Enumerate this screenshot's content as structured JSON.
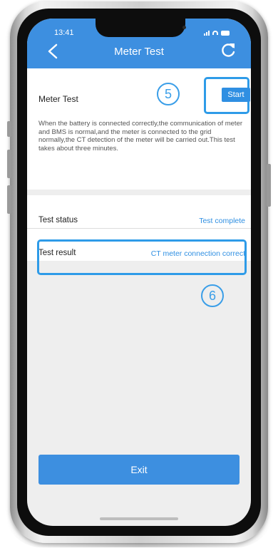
{
  "status_bar": {
    "time": "13:41"
  },
  "nav": {
    "title": "Meter Test"
  },
  "meter_test": {
    "label": "Meter Test",
    "start_label": "Start",
    "description": "When the battery is connected correctly,the communication of meter and BMS is normal,and the meter is connected to the grid normally,the CT detection of the meter will be carried out.This test takes about three minutes."
  },
  "test_status": {
    "label": "Test status",
    "value": "Test complete"
  },
  "test_result": {
    "label": "Test result",
    "value": "CT meter connection correct"
  },
  "annotations": {
    "step_5": "5",
    "step_6": "6"
  },
  "footer": {
    "exit_label": "Exit"
  },
  "icons": [
    "back-arrow-icon",
    "refresh-icon",
    "signal-icon",
    "wifi-icon",
    "battery-icon"
  ],
  "colors": {
    "nav_blue": "#3d8fe0",
    "accent_blue": "#2f8fe2",
    "highlight_blue": "#2e9be8",
    "background": "#eeeeee"
  }
}
